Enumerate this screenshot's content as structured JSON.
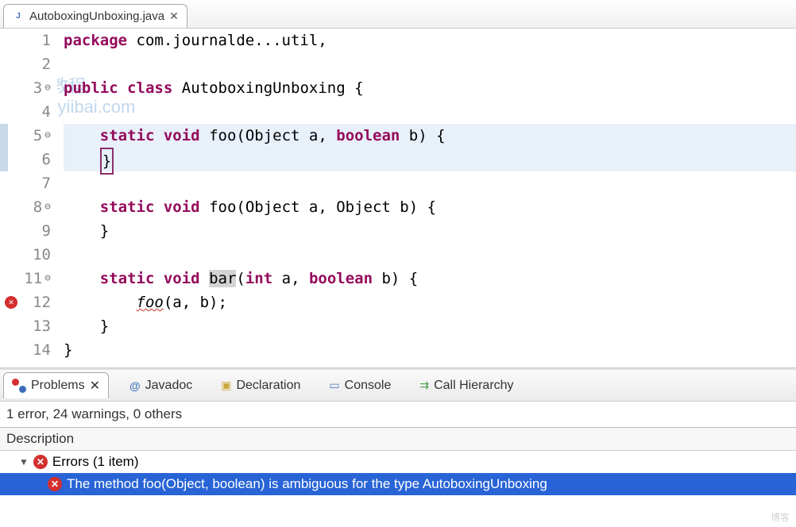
{
  "editor": {
    "tab_title": "AutoboxingUnboxing.java",
    "lines": [
      {
        "n": 1,
        "fold": false
      },
      {
        "n": 2,
        "fold": false
      },
      {
        "n": 3,
        "fold": true
      },
      {
        "n": 4,
        "fold": false
      },
      {
        "n": 5,
        "fold": true
      },
      {
        "n": 6,
        "fold": false
      },
      {
        "n": 7,
        "fold": false
      },
      {
        "n": 8,
        "fold": true
      },
      {
        "n": 9,
        "fold": false
      },
      {
        "n": 10,
        "fold": false
      },
      {
        "n": 11,
        "fold": true
      },
      {
        "n": 12,
        "fold": false,
        "error": true
      },
      {
        "n": 13,
        "fold": false
      },
      {
        "n": 14,
        "fold": false
      }
    ],
    "code": {
      "line1_prefix": "package",
      "line1_rest": " com.journalde...util,",
      "line3_public": "public",
      "line3_class": "class",
      "line3_name": "AutoboxingUnboxing",
      "line3_brace": "{",
      "line5_static": "static",
      "line5_void": "void",
      "line5_foo": "foo",
      "line5_sig": "(Object a, ",
      "line5_bool": "boolean",
      "line5_rest": " b) {",
      "line6_brace": "}",
      "line8_static": "static",
      "line8_void": "void",
      "line8_foo": "foo",
      "line8_sig": "(Object a, Object b) {",
      "line9_brace": "}",
      "line11_static": "static",
      "line11_void": "void",
      "line11_bar": "bar",
      "line11_sig_open": "(",
      "line11_int": "int",
      "line11_sig_mid": " a, ",
      "line11_bool": "boolean",
      "line11_sig_rest": " b) {",
      "line12_foo": "foo",
      "line12_args": "(a, b);",
      "line13_brace": "}",
      "line14_brace": "}"
    },
    "watermark_l1": "易百教程",
    "watermark_l2": "www.yiibai.com"
  },
  "bottom": {
    "tabs": {
      "problems": "Problems",
      "javadoc": "Javadoc",
      "declaration": "Declaration",
      "console": "Console",
      "call_hierarchy": "Call Hierarchy"
    },
    "summary": "1 error, 24 warnings, 0 others",
    "header": "Description",
    "errors_group": "Errors (1 item)",
    "error_msg": "The method foo(Object, boolean) is ambiguous for the type AutoboxingUnboxing"
  },
  "footer_watermark": "博客"
}
